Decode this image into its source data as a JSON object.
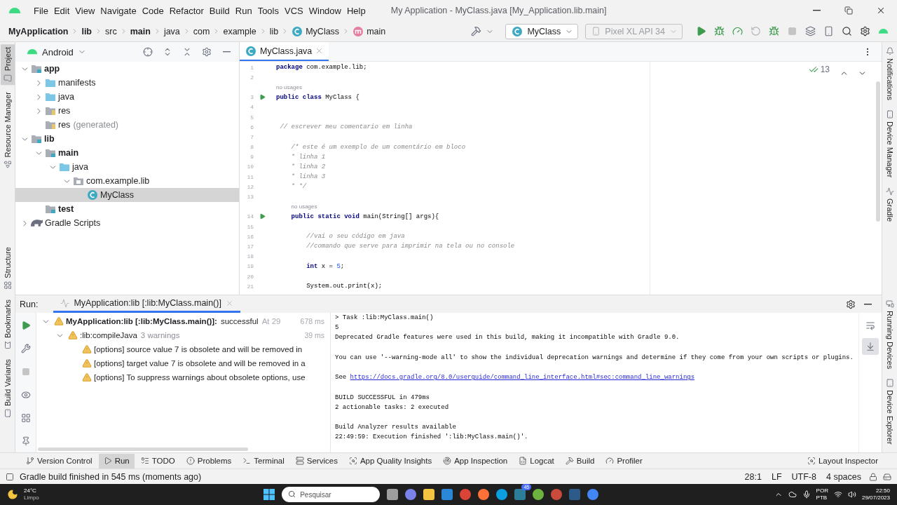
{
  "window": {
    "title": "My Application - MyClass.java [My_Application.lib.main]"
  },
  "menu": [
    "File",
    "Edit",
    "View",
    "Navigate",
    "Code",
    "Refactor",
    "Build",
    "Run",
    "Tools",
    "VCS",
    "Window",
    "Help"
  ],
  "breadcrumbs": [
    {
      "label": "MyApplication",
      "kind": "module"
    },
    {
      "label": "lib",
      "kind": "module"
    },
    {
      "label": "src",
      "kind": "plain"
    },
    {
      "label": "main",
      "kind": "module"
    },
    {
      "label": "java",
      "kind": "plain"
    },
    {
      "label": "com",
      "kind": "plain"
    },
    {
      "label": "example",
      "kind": "plain"
    },
    {
      "label": "lib",
      "kind": "plain"
    },
    {
      "label": "MyClass",
      "kind": "class"
    },
    {
      "label": "main",
      "kind": "method"
    }
  ],
  "toolbar": {
    "run_config": "MyClass",
    "device": {
      "label": "Pixel XL API 34",
      "disabled": true
    }
  },
  "left_stripe": {
    "top": [
      {
        "label": "Project",
        "selected": true
      },
      {
        "label": "Resource Manager",
        "selected": false
      }
    ],
    "middle": [
      {
        "label": "Structure",
        "selected": false
      }
    ],
    "bottom": [
      {
        "label": "Bookmarks",
        "selected": false
      },
      {
        "label": "Build Variants",
        "selected": false
      }
    ]
  },
  "right_stripe": {
    "top": [
      {
        "label": "Notifications",
        "selected": false
      },
      {
        "label": "Device Manager",
        "selected": false
      },
      {
        "label": "Gradle",
        "selected": false
      }
    ],
    "bottom": [
      {
        "label": "Running Devices",
        "selected": false
      },
      {
        "label": "Device Explorer",
        "selected": false
      }
    ]
  },
  "project": {
    "view": "Android",
    "tree": [
      {
        "label": "app",
        "kind": "module",
        "expanded": true,
        "selected": false,
        "children": [
          {
            "label": "manifests",
            "kind": "folder",
            "expanded": false,
            "selected": false
          },
          {
            "label": "java",
            "kind": "folder",
            "expanded": false,
            "selected": false
          },
          {
            "label": "res",
            "kind": "res",
            "expanded": false,
            "selected": false
          },
          {
            "label": "res",
            "note": "(generated)",
            "kind": "res",
            "selected": false
          }
        ]
      },
      {
        "label": "lib",
        "kind": "module",
        "expanded": true,
        "selected": false,
        "children": [
          {
            "label": "main",
            "kind": "module",
            "expanded": true,
            "selected": false,
            "children": [
              {
                "label": "java",
                "kind": "folder",
                "expanded": true,
                "selected": false,
                "children": [
                  {
                    "label": "com.example.lib",
                    "kind": "package",
                    "expanded": true,
                    "selected": false,
                    "children": [
                      {
                        "label": "MyClass",
                        "kind": "class",
                        "selected": true
                      }
                    ]
                  }
                ]
              }
            ]
          },
          {
            "label": "test",
            "kind": "module",
            "selected": false
          }
        ]
      },
      {
        "label": "Gradle Scripts",
        "kind": "gradle",
        "expanded": false,
        "selected": false
      }
    ]
  },
  "editor": {
    "tab": {
      "label": "MyClass.java",
      "selected": true
    },
    "inspections": "13",
    "lines": [
      {
        "kind": "code",
        "number": "1",
        "run": false,
        "segments": [
          {
            "text": "package",
            "kind": "keyword"
          },
          {
            "text": " com.example.lib;",
            "kind": "plain"
          }
        ]
      },
      {
        "kind": "blank",
        "number": "2"
      },
      {
        "kind": "hint",
        "text": "no usages"
      },
      {
        "kind": "code",
        "number": "3",
        "run": true,
        "segments": [
          {
            "text": "public class",
            "kind": "keyword"
          },
          {
            "text": " MyClass {",
            "kind": "plain"
          }
        ]
      },
      {
        "kind": "blank",
        "number": "4"
      },
      {
        "kind": "blank",
        "number": "5"
      },
      {
        "kind": "code",
        "number": "6",
        "run": false,
        "segments": [
          {
            "text": " // escrever meu comentario em linha",
            "kind": "comment"
          }
        ]
      },
      {
        "kind": "blank",
        "number": "7"
      },
      {
        "kind": "code",
        "number": "8",
        "run": false,
        "segments": [
          {
            "text": "    /* este é um exemplo de um comentário em bloco",
            "kind": "comment"
          }
        ]
      },
      {
        "kind": "code",
        "number": "9",
        "run": false,
        "segments": [
          {
            "text": "    * linha 1",
            "kind": "comment"
          }
        ]
      },
      {
        "kind": "code",
        "number": "10",
        "run": false,
        "segments": [
          {
            "text": "    * linha 2",
            "kind": "comment"
          }
        ]
      },
      {
        "kind": "code",
        "number": "11",
        "run": false,
        "segments": [
          {
            "text": "    * linha 3",
            "kind": "comment"
          }
        ]
      },
      {
        "kind": "code",
        "number": "12",
        "run": false,
        "segments": [
          {
            "text": "    * */",
            "kind": "comment"
          }
        ]
      },
      {
        "kind": "blank",
        "number": "13"
      },
      {
        "kind": "hint",
        "text": "no usages"
      },
      {
        "kind": "code",
        "number": "14",
        "run": true,
        "segments": [
          {
            "text": "    public static void",
            "kind": "keyword"
          },
          {
            "text": " main(String[] args){",
            "kind": "plain"
          }
        ]
      },
      {
        "kind": "blank",
        "number": "15"
      },
      {
        "kind": "code",
        "number": "16",
        "run": false,
        "segments": [
          {
            "text": "        //vai o seu código em java",
            "kind": "comment"
          }
        ]
      },
      {
        "kind": "code",
        "number": "17",
        "run": false,
        "segments": [
          {
            "text": "        //comando que serve para imprimir na tela ou no console",
            "kind": "comment"
          }
        ]
      },
      {
        "kind": "blank",
        "number": "18"
      },
      {
        "kind": "code",
        "number": "19",
        "run": false,
        "segments": [
          {
            "text": "        int",
            "kind": "keyword"
          },
          {
            "text": " x = ",
            "kind": "plain"
          },
          {
            "text": "5",
            "kind": "number"
          },
          {
            "text": ";",
            "kind": "plain"
          }
        ]
      },
      {
        "kind": "blank",
        "number": "20"
      },
      {
        "kind": "code",
        "number": "21",
        "run": false,
        "segments": [
          {
            "text": "        System.out.print(x);",
            "kind": "plain"
          }
        ]
      }
    ]
  },
  "run": {
    "label": "Run:",
    "tab": {
      "label": "MyApplication:lib [:lib:MyClass.main()]",
      "selected": true
    },
    "tree": [
      {
        "kind": "build",
        "label": "MyApplication:lib [:lib:MyClass.main()]:",
        "status": "successful",
        "time": "At 29",
        "duration": "678 ms",
        "expanded": true,
        "children": [
          {
            "kind": "task",
            "label": ":lib:compileJava",
            "status": "3 warnings",
            "duration": "39 ms",
            "expanded": true,
            "children": [
              {
                "kind": "warning",
                "label": "[options] source value 7 is obsolete and will be removed in"
              },
              {
                "kind": "warning",
                "label": "[options] target value 7 is obsolete and will be removed in a"
              },
              {
                "kind": "warning",
                "label": "[options] To suppress warnings about obsolete options, use"
              }
            ]
          }
        ]
      }
    ],
    "console": [
      {
        "kind": "text",
        "text": "> Task :lib:MyClass.main()"
      },
      {
        "kind": "text",
        "text": "5"
      },
      {
        "kind": "text",
        "text": "Deprecated Gradle features were used in this build, making it incompatible with Gradle 9.0."
      },
      {
        "kind": "blank"
      },
      {
        "kind": "text",
        "text": "You can use '--warning-mode all' to show the individual deprecation warnings and determine if they come from your own scripts or plugins."
      },
      {
        "kind": "blank"
      },
      {
        "kind": "link",
        "text": "See ",
        "link": "https://docs.gradle.org/8.0/userguide/command_line_interface.html#sec:command_line_warnings"
      },
      {
        "kind": "blank"
      },
      {
        "kind": "text",
        "text": "BUILD SUCCESSFUL in 479ms"
      },
      {
        "kind": "text",
        "text": "2 actionable tasks: 2 executed"
      },
      {
        "kind": "blank"
      },
      {
        "kind": "text",
        "text": "Build Analyzer results available"
      },
      {
        "kind": "text",
        "text": "22:49:59: Execution finished ':lib:MyClass.main()'."
      }
    ]
  },
  "tool_windows": {
    "left": [
      {
        "label": "Version Control",
        "selected": false
      },
      {
        "label": "Run",
        "selected": true
      },
      {
        "label": "TODO",
        "selected": false
      },
      {
        "label": "Problems",
        "selected": false
      },
      {
        "label": "Terminal",
        "selected": false
      },
      {
        "label": "Services",
        "selected": false
      },
      {
        "label": "App Quality Insights",
        "selected": false
      },
      {
        "label": "App Inspection",
        "selected": false
      },
      {
        "label": "Logcat",
        "selected": false
      },
      {
        "label": "Build",
        "selected": false
      },
      {
        "label": "Profiler",
        "selected": false
      }
    ],
    "right": [
      {
        "label": "Layout Inspector",
        "selected": false
      }
    ]
  },
  "status_bar": {
    "message": "Gradle build finished in 545 ms (moments ago)",
    "items": [
      "28:1",
      "LF",
      "UTF-8",
      "4 spaces"
    ]
  },
  "taskbar": {
    "temperature": "24°C",
    "weather": "Limpo",
    "search": {
      "placeholder": "Pesquisar"
    },
    "badge": "45",
    "language": "POR",
    "layout": "PTB",
    "time": "22:50",
    "date": "29/07/2023"
  }
}
